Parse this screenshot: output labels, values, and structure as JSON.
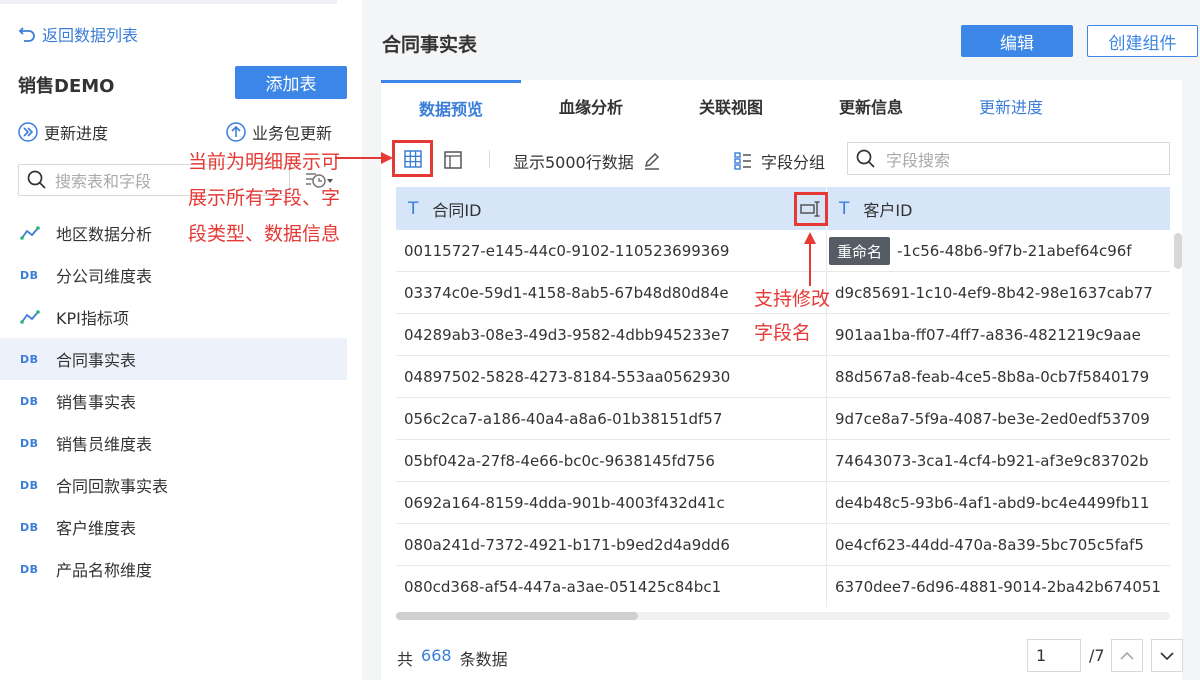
{
  "sidebar": {
    "back_link": "返回数据列表",
    "project_title": "销售DEMO",
    "add_table_label": "添加表",
    "update_progress_label": "更新进度",
    "business_update_label": "业务包更新",
    "search_placeholder": "搜索表和字段",
    "items": [
      {
        "label": "地区数据分析",
        "icon": "analysis-icon"
      },
      {
        "label": "分公司维度表",
        "icon": "db-icon"
      },
      {
        "label": "KPI指标项",
        "icon": "analysis-icon"
      },
      {
        "label": "合同事实表",
        "icon": "db-icon",
        "active": true
      },
      {
        "label": "销售事实表",
        "icon": "db-icon"
      },
      {
        "label": "销售员维度表",
        "icon": "db-icon"
      },
      {
        "label": "合同回款事实表",
        "icon": "db-icon"
      },
      {
        "label": "客户维度表",
        "icon": "db-icon"
      },
      {
        "label": "产品名称维度",
        "icon": "db-icon"
      }
    ],
    "db_icon_text": "DB"
  },
  "header": {
    "title": "合同事实表",
    "edit_label": "编辑",
    "create_component_label": "创建组件"
  },
  "tabs": [
    {
      "label": "数据预览",
      "active": true
    },
    {
      "label": "血缘分析"
    },
    {
      "label": "关联视图"
    },
    {
      "label": "更新信息"
    },
    {
      "label": "更新进度"
    }
  ],
  "toolbar": {
    "rows_label": "显示5000行数据",
    "group_label": "字段分组",
    "field_search_placeholder": "字段搜索"
  },
  "table": {
    "columns": [
      {
        "type_icon": "T",
        "label": "合同ID"
      },
      {
        "type_icon": "T",
        "label": "客户ID"
      }
    ],
    "rows": [
      [
        "00115727-e145-44c0-9102-110523699369",
        "-1c56-48b6-9f7b-21abef64c96f"
      ],
      [
        "03374c0e-59d1-4158-8ab5-67b48d80d84e",
        "d9c85691-1c10-4ef9-8b42-98e1637cab77"
      ],
      [
        "04289ab3-08e3-49d3-9582-4dbb945233e7",
        "901aa1ba-ff07-4ff7-a836-4821219c9aae"
      ],
      [
        "04897502-5828-4273-8184-553aa0562930",
        "88d567a8-feab-4ce5-8b8a-0cb7f5840179"
      ],
      [
        "056c2ca7-a186-40a4-a8a6-01b38151df57",
        "9d7ce8a7-5f9a-4087-be3e-2ed0edf53709"
      ],
      [
        "05bf042a-27f8-4e66-bc0c-9638145fd756",
        "74643073-3ca1-4cf4-b921-af3e9c83702b"
      ],
      [
        "0692a164-8159-4dda-901b-4003f432d41c",
        "de4b48c5-93b6-4af1-abd9-bc4e4499fb11"
      ],
      [
        "080a241d-7372-4921-b171-b9ed2d4a9dd6",
        "0e4cf623-44dd-470a-8a39-5bc705c5faf5"
      ],
      [
        "080cd368-af54-447a-a3ae-051425c84bc1",
        "6370dee7-6d96-4881-9014-2ba42b674051"
      ]
    ],
    "rename_tooltip": "重命名"
  },
  "footer": {
    "prefix": "共",
    "count": "668",
    "suffix": "条数据",
    "page_value": "1",
    "page_total": "/7"
  },
  "annotations": {
    "left_note": "当前为明细展示可展示所有字段、字段类型、数据信息",
    "right_note": "支持修改字段名"
  },
  "colors": {
    "accent": "#3b86e6",
    "annotation_red": "#e53935",
    "header_row": "#d7e5f8"
  }
}
